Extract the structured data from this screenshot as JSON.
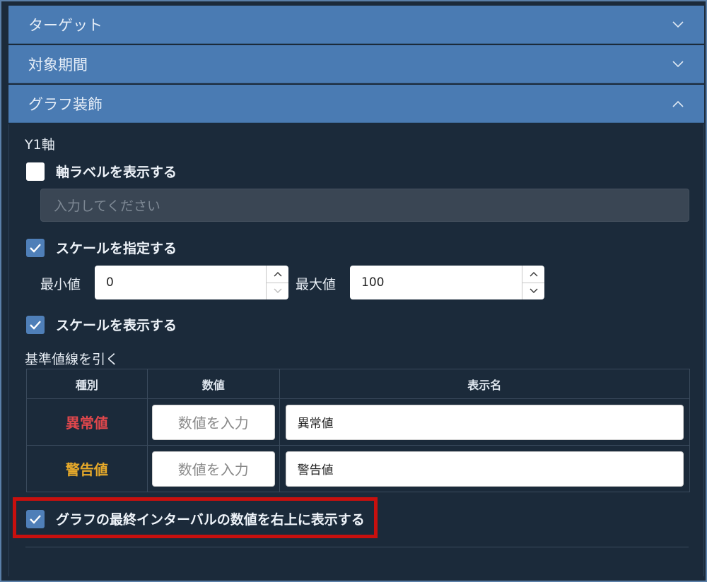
{
  "accordion": {
    "target_title": "ターゲット",
    "period_title": "対象期間",
    "decoration_title": "グラフ装飾"
  },
  "y1": {
    "section_label": "Y1軸",
    "axis_label_checkbox": {
      "label": "軸ラベルを表示する",
      "checked": false
    },
    "axis_label_input": {
      "placeholder": "入力してください",
      "value": ""
    },
    "scale_checkbox": {
      "label": "スケールを指定する",
      "checked": true
    },
    "min": {
      "label": "最小値",
      "value": "0"
    },
    "max": {
      "label": "最大値",
      "value": "100"
    },
    "show_scale_checkbox": {
      "label": "スケールを表示する",
      "checked": true
    }
  },
  "reference_lines": {
    "section_label": "基準値線を引く",
    "columns": [
      "種別",
      "数値",
      "表示名"
    ],
    "rows": [
      {
        "type": "異常値",
        "color": "#e0474c",
        "value_placeholder": "数値を入力",
        "display_name": "異常値"
      },
      {
        "type": "警告値",
        "color": "#e6a92a",
        "value_placeholder": "数値を入力",
        "display_name": "警告値"
      }
    ]
  },
  "last_interval_checkbox": {
    "label": "グラフの最終インターバルの数値を右上に表示する",
    "checked": true
  },
  "colors": {
    "header": "#4a7bb3",
    "background": "#1b2a3a",
    "checkbox_on": "#4f7fb8",
    "highlight": "#c8100e"
  }
}
